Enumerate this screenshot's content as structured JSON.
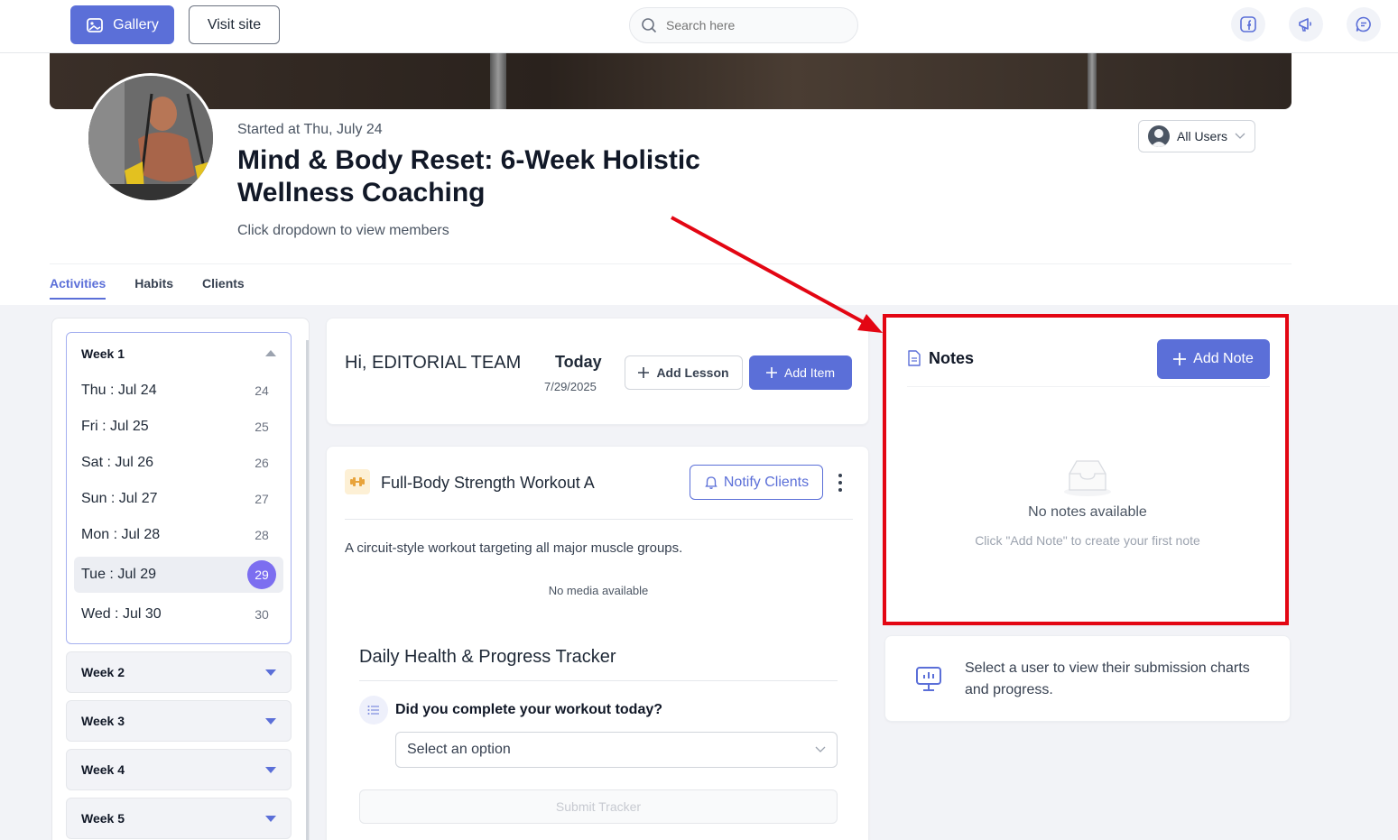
{
  "header": {
    "gallery_label": "Gallery",
    "visit_label": "Visit site",
    "search_placeholder": "Search here"
  },
  "program": {
    "started": "Started at Thu, July 24",
    "title": "Mind & Body Reset: 6-Week Holistic Wellness Coaching",
    "hint": "Click dropdown to view members",
    "users_label": "All Users"
  },
  "tabs": [
    {
      "label": "Activities"
    },
    {
      "label": "Habits"
    },
    {
      "label": "Clients"
    }
  ],
  "weeks": {
    "open": {
      "label": "Week 1",
      "days": [
        {
          "label": "Thu : Jul 24",
          "num": "24"
        },
        {
          "label": "Fri : Jul 25",
          "num": "25"
        },
        {
          "label": "Sat : Jul 26",
          "num": "26"
        },
        {
          "label": "Sun : Jul 27",
          "num": "27"
        },
        {
          "label": "Mon : Jul 28",
          "num": "28"
        },
        {
          "label": "Tue : Jul 29",
          "num": "29"
        },
        {
          "label": "Wed : Jul 30",
          "num": "30"
        }
      ]
    },
    "closed": [
      {
        "label": "Week 2"
      },
      {
        "label": "Week 3"
      },
      {
        "label": "Week 4"
      },
      {
        "label": "Week 5"
      }
    ]
  },
  "today_card": {
    "greeting": "Hi, EDITORIAL TEAM",
    "today_label": "Today",
    "date": "7/29/2025",
    "add_lesson": "Add Lesson",
    "add_item": "Add Item"
  },
  "workout": {
    "title": "Full-Body Strength Workout A",
    "notify": "Notify Clients",
    "description": "A circuit-style workout targeting all major muscle groups.",
    "no_media": "No media available",
    "tracker_title": "Daily Health & Progress Tracker",
    "question": "Did you complete your workout today?",
    "select_placeholder": "Select an option",
    "submit": "Submit Tracker"
  },
  "notes": {
    "title": "Notes",
    "add_note": "Add Note",
    "empty_title": "No notes available",
    "empty_sub": "Click \"Add Note\" to create your first note"
  },
  "charts_card": {
    "message": "Select a user to view their submission charts and progress."
  },
  "colors": {
    "accent": "#5b6fd8",
    "highlight": "#e30613",
    "selected_day": "#7c6ef0"
  }
}
